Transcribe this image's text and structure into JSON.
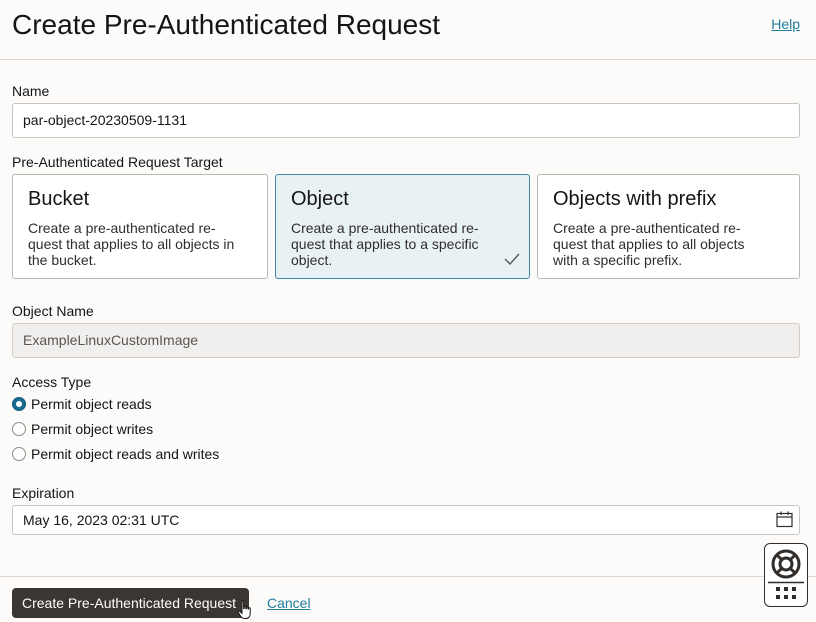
{
  "header": {
    "title": "Create Pre-Authenticated Request",
    "help_label": "Help"
  },
  "name_field": {
    "label": "Name",
    "value": "par-object-20230509-1131"
  },
  "target": {
    "label": "Pre-Authenticated Request Target",
    "options": [
      {
        "title": "Bucket",
        "desc_lines": [
          "Create a pre-authenticated re-",
          "quest that applies to all objects in",
          "the bucket."
        ],
        "selected": false
      },
      {
        "title": "Object",
        "desc_lines": [
          "Create a pre-authenticated re-",
          "quest that applies to a specific",
          "object."
        ],
        "selected": true
      },
      {
        "title": "Objects with prefix",
        "desc_lines": [
          "Create a pre-authenticated re-",
          "quest that applies to all objects",
          "with a specific prefix."
        ],
        "selected": false
      }
    ]
  },
  "object_name": {
    "label": "Object Name",
    "value": "ExampleLinuxCustomImage"
  },
  "access_type": {
    "label": "Access Type",
    "options": [
      {
        "label": "Permit object reads",
        "checked": true
      },
      {
        "label": "Permit object writes",
        "checked": false
      },
      {
        "label": "Permit object reads and writes",
        "checked": false
      }
    ]
  },
  "expiration": {
    "label": "Expiration",
    "value": "May 16, 2023 02:31 UTC"
  },
  "footer": {
    "create_label": "Create Pre-Authenticated Request",
    "cancel_label": "Cancel"
  },
  "icons": {
    "check": "check-icon",
    "calendar": "calendar-icon",
    "lifebuoy": "lifebuoy-icon",
    "grid": "grid-icon",
    "cursor": "hand-cursor-icon"
  },
  "colors": {
    "accent": "#227e9e",
    "selected_card_bg": "#e8f2f5",
    "primary_button": "#3a3631"
  }
}
